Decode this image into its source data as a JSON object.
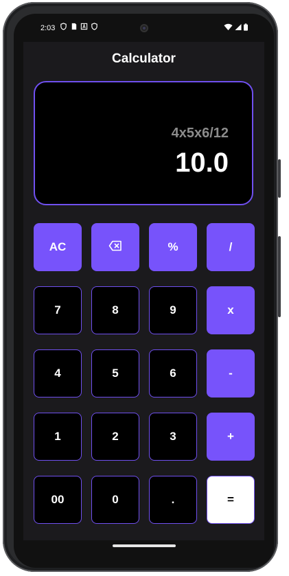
{
  "status_bar": {
    "time": "2:03",
    "left_icons": [
      "shield-icon",
      "sim-card-icon",
      "a-square-icon",
      "shield-icon"
    ],
    "right_icons": [
      "wifi-icon",
      "signal-icon",
      "battery-icon"
    ]
  },
  "app": {
    "title": "Calculator",
    "accent_color": "#7753fb"
  },
  "display": {
    "expression": "4x5x6/12",
    "result": "10.0"
  },
  "keypad": {
    "rows": [
      [
        {
          "label": "AC",
          "kind": "op"
        },
        {
          "label": "",
          "icon": "backspace-icon",
          "kind": "op"
        },
        {
          "label": "%",
          "kind": "op"
        },
        {
          "label": "/",
          "kind": "op"
        }
      ],
      [
        {
          "label": "7",
          "kind": "digit"
        },
        {
          "label": "8",
          "kind": "digit"
        },
        {
          "label": "9",
          "kind": "digit"
        },
        {
          "label": "x",
          "kind": "op"
        }
      ],
      [
        {
          "label": "4",
          "kind": "digit"
        },
        {
          "label": "5",
          "kind": "digit"
        },
        {
          "label": "6",
          "kind": "digit"
        },
        {
          "label": "-",
          "kind": "op"
        }
      ],
      [
        {
          "label": "1",
          "kind": "digit"
        },
        {
          "label": "2",
          "kind": "digit"
        },
        {
          "label": "3",
          "kind": "digit"
        },
        {
          "label": "+",
          "kind": "op"
        }
      ],
      [
        {
          "label": "00",
          "kind": "digit"
        },
        {
          "label": "0",
          "kind": "digit"
        },
        {
          "label": ".",
          "kind": "digit"
        },
        {
          "label": "=",
          "kind": "equals"
        }
      ]
    ]
  }
}
